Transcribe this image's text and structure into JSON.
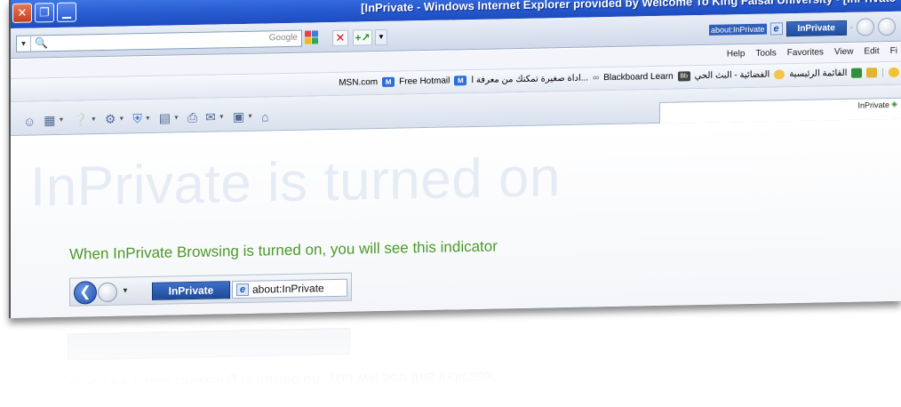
{
  "window": {
    "title": "[InPrivate - Windows Internet Explorer provided by Welcome To King Faisal University - [InPrivate",
    "caption_buttons": [
      "close-icon",
      "restore-icon",
      "minimize-icon"
    ]
  },
  "searchbar": {
    "placeholder": "Google",
    "address_text": "about:InPrivate",
    "inprivate_label": "InPrivate",
    "stop_symbol": "✕",
    "add_symbol": "+"
  },
  "menu": {
    "items": [
      "Help",
      "Tools",
      "Favorites",
      "View",
      "Edit",
      "Fi"
    ]
  },
  "favorites": {
    "items": [
      "MSN.com",
      "Free Hotmail",
      "...اداة صغيرة تمكنك من معرفة ا",
      "Blackboard Learn",
      "الفضائية - البث الحي",
      "القائمة الرئيسية"
    ]
  },
  "commandbar": {
    "inprivate_indicator": "InPrivate"
  },
  "content": {
    "heading": "InPrivate is turned on",
    "subtext": "When InPrivate Browsing is turned on, you will see this indicator",
    "indicator_label": "InPrivate",
    "indicator_address": "about:InPrivate"
  },
  "colors": {
    "titlebar": "#2b5fd4",
    "accent_green": "#4c9a2a",
    "inprivate_blue": "#1f4e9e",
    "heading_ghost": "#e6ecf5"
  }
}
